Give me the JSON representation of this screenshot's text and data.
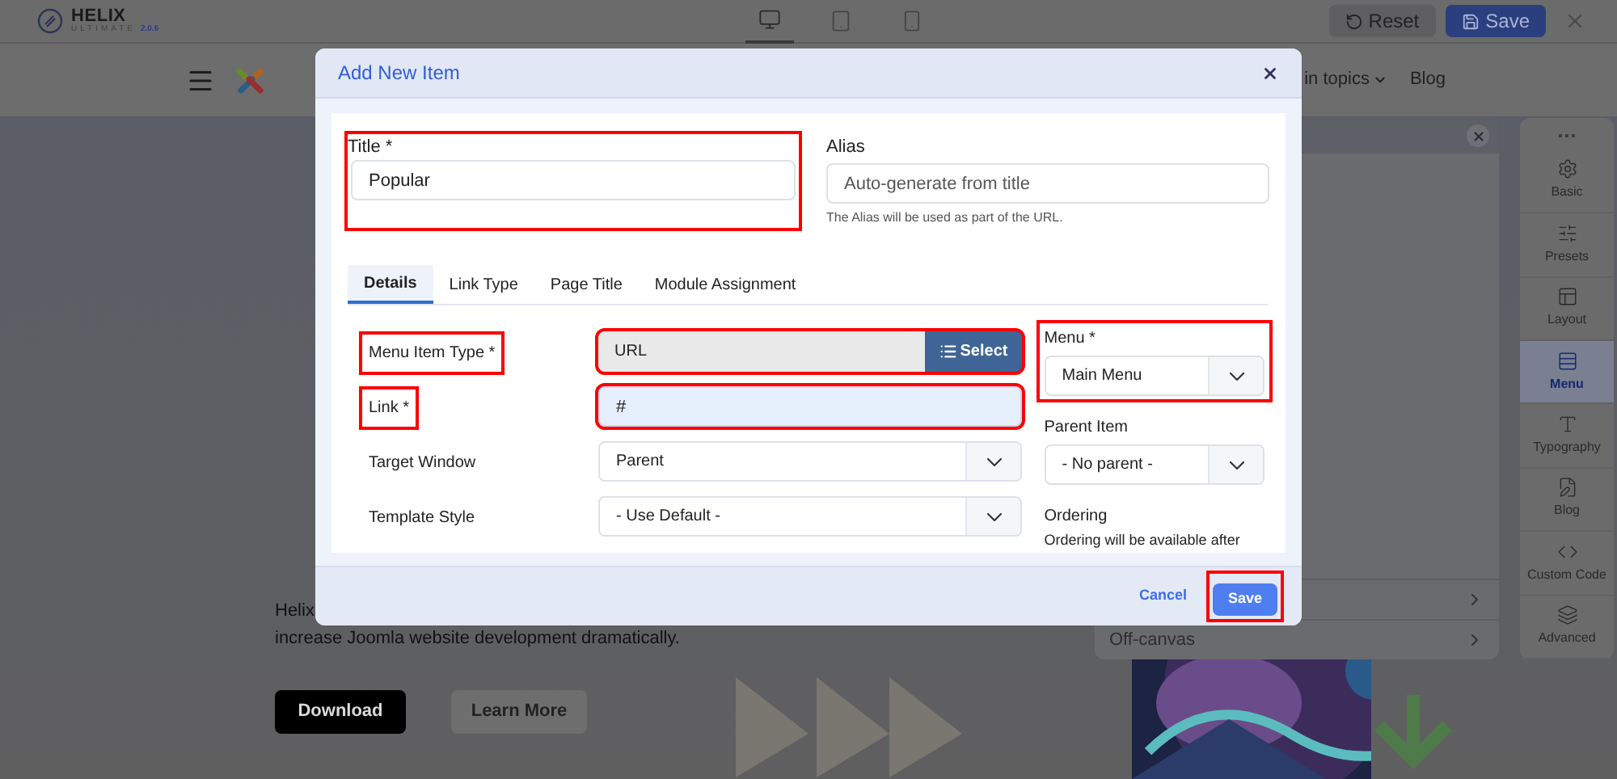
{
  "builder_bar": {
    "logo": {
      "name": "HELIX",
      "subtitle": "ULTIMATE",
      "version": "2.0.6"
    },
    "devices": [
      {
        "kind": "desktop",
        "selected": true
      },
      {
        "kind": "tablet",
        "selected": false
      },
      {
        "kind": "phone",
        "selected": false
      }
    ],
    "reset_label": "Reset",
    "save_label": "Save"
  },
  "site": {
    "nav": [
      {
        "label": "in topics",
        "kind": "dropdown"
      },
      {
        "label": "Blog",
        "kind": "link"
      }
    ],
    "hero": {
      "text_lines": [
        "Helix",
        "increase Joomla website development dramatically."
      ],
      "buttons": [
        {
          "label": "Download",
          "kind": "primary"
        },
        {
          "label": "Learn More",
          "kind": "secondary"
        }
      ]
    }
  },
  "options_panel": {
    "rows": [
      {
        "label": ""
      },
      {
        "label": "Off-canvas"
      }
    ]
  },
  "sidebar": {
    "items": [
      {
        "label": "Basic",
        "kind": "basic",
        "selected": false
      },
      {
        "label": "Presets",
        "kind": "presets",
        "selected": false
      },
      {
        "label": "Layout",
        "kind": "layout",
        "selected": false
      },
      {
        "label": "Menu",
        "kind": "menu",
        "selected": true
      },
      {
        "label": "Typography",
        "kind": "typography",
        "selected": false
      },
      {
        "label": "Blog",
        "kind": "blog",
        "selected": false
      },
      {
        "label": "Custom Code",
        "kind": "code",
        "selected": false
      },
      {
        "label": "Advanced",
        "kind": "advanced",
        "selected": false
      }
    ]
  },
  "dialog": {
    "title": "Add New Item",
    "title_field": {
      "label": "Title *",
      "value": "Popular",
      "highlighted": true
    },
    "alias_field": {
      "label": "Alias",
      "placeholder": "Auto-generate from title",
      "help": "The Alias will be used as part of the URL.",
      "highlighted": false
    },
    "tabs": [
      {
        "label": "Details",
        "selected": true
      },
      {
        "label": "Link Type",
        "selected": false
      },
      {
        "label": "Page Title",
        "selected": false
      },
      {
        "label": "Module Assignment",
        "selected": false
      }
    ],
    "rows": [
      {
        "label": "Menu Item Type *",
        "kind": "picker",
        "value": "URL",
        "button": "Select",
        "label_highlighted": true,
        "control_highlighted": true
      },
      {
        "label": "Link *",
        "kind": "input",
        "value": "#",
        "label_highlighted": true,
        "control_highlighted": true
      },
      {
        "label": "Target Window",
        "kind": "select",
        "value": "Parent",
        "label_highlighted": false,
        "control_highlighted": false
      },
      {
        "label": "Template Style",
        "kind": "select",
        "value": "- Use Default -",
        "label_highlighted": false,
        "control_highlighted": false
      }
    ],
    "side_fields": [
      {
        "label": "Menu *",
        "kind": "select",
        "value": "Main Menu",
        "highlighted": true
      },
      {
        "label": "Parent Item",
        "kind": "select",
        "value": "- No parent -",
        "highlighted": false
      },
      {
        "label": "Ordering",
        "kind": "note",
        "value": "Ordering will be available after",
        "highlighted": false
      }
    ],
    "cancel_label": "Cancel",
    "save_label": "Save",
    "save_highlighted": true
  }
}
